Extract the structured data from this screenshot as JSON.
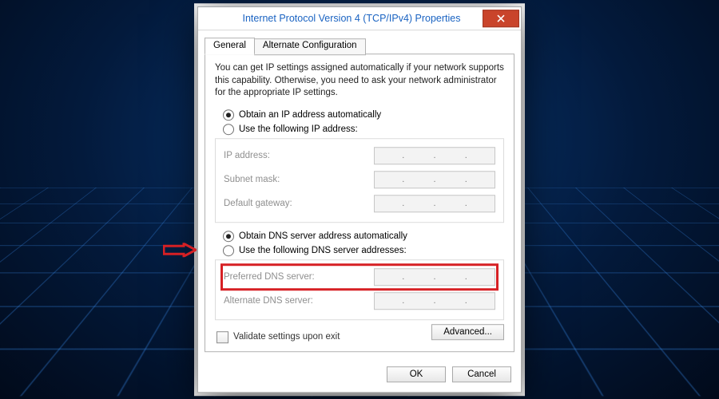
{
  "window": {
    "title": "Internet Protocol Version 4 (TCP/IPv4) Properties"
  },
  "tabs": {
    "general": "General",
    "alternate": "Alternate Configuration"
  },
  "intro": "You can get IP settings assigned automatically if your network supports this capability. Otherwise, you need to ask your network administrator for the appropriate IP settings.",
  "ip": {
    "auto": "Obtain an IP address automatically",
    "manual": "Use the following IP address:",
    "address_label": "IP address:",
    "subnet_label": "Subnet mask:",
    "gateway_label": "Default gateway:"
  },
  "dns": {
    "auto": "Obtain DNS server address automatically",
    "manual": "Use the following DNS server addresses:",
    "preferred_label": "Preferred DNS server:",
    "alternate_label": "Alternate DNS server:"
  },
  "validate": "Validate settings upon exit",
  "buttons": {
    "advanced": "Advanced...",
    "ok": "OK",
    "cancel": "Cancel"
  },
  "ip_placeholder_dots": [
    "·",
    "·",
    "·"
  ]
}
